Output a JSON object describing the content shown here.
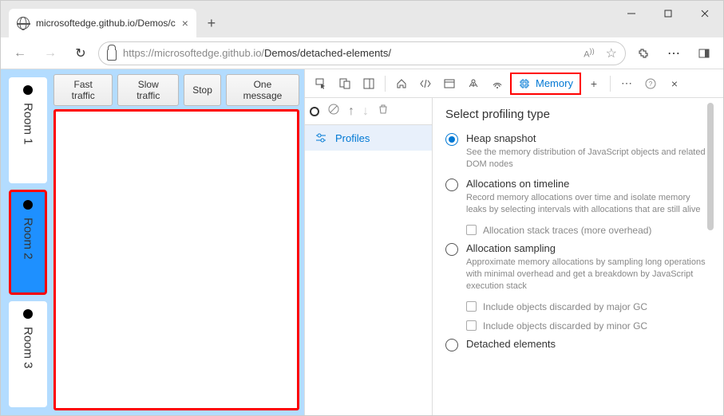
{
  "tab": {
    "title": "microsoftedge.github.io/Demos/c"
  },
  "url": {
    "prefix": "https://microsoftedge.github.io/",
    "suffix": "Demos/detached-elements/"
  },
  "rooms": [
    {
      "label": "Room 1",
      "selected": false
    },
    {
      "label": "Room 2",
      "selected": true
    },
    {
      "label": "Room 3",
      "selected": false
    }
  ],
  "buttons": [
    "Fast traffic",
    "Slow traffic",
    "Stop",
    "One message"
  ],
  "devtools": {
    "memory_tab": "Memory",
    "profiles": "Profiles",
    "heading": "Select profiling type",
    "options": [
      {
        "title": "Heap snapshot",
        "desc": "See the memory distribution of JavaScript objects and related DOM nodes",
        "selected": true
      },
      {
        "title": "Allocations on timeline",
        "desc": "Record memory allocations over time and isolate memory leaks by selecting intervals with allocations that are still alive",
        "selected": false
      },
      {
        "title": "Allocation sampling",
        "desc": "Approximate memory allocations by sampling long operations with minimal overhead and get a breakdown by JavaScript execution stack",
        "selected": false
      },
      {
        "title": "Detached elements",
        "desc": "",
        "selected": false
      }
    ],
    "checkboxes": {
      "stack_traces": "Allocation stack traces (more overhead)",
      "major_gc": "Include objects discarded by major GC",
      "minor_gc": "Include objects discarded by minor GC"
    }
  }
}
